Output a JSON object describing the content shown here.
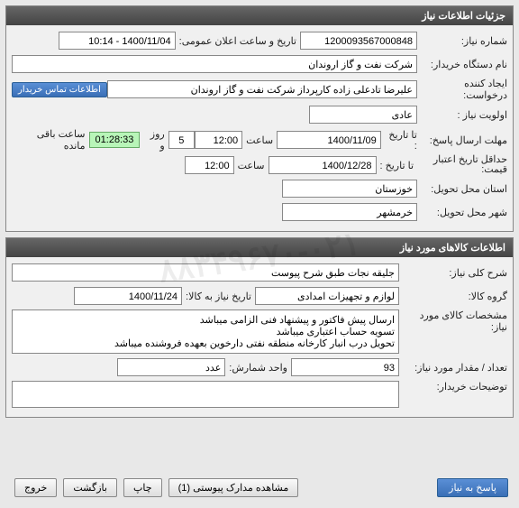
{
  "panel1": {
    "title": "جزئیات اطلاعات نیاز",
    "need_no_label": "شماره نیاز:",
    "need_no": "1200093567000848",
    "announce_label": "تاریخ و ساعت اعلان عمومی:",
    "announce_val": "1400/11/04 - 10:14",
    "buyer_label": "نام دستگاه خریدار:",
    "buyer_val": "شرکت نفت و گاز اروندان",
    "creator_label": "ایجاد کننده درخواست:",
    "creator_val": "علیرضا تادعلی زاده کارپرداز شرکت نفت و گاز اروندان",
    "contact_btn": "اطلاعات تماس خریدار",
    "priority_label": "اولویت نیاز :",
    "priority_val": "عادی",
    "deadline_label": "مهلت ارسال پاسخ:",
    "to_date_label": "تا تاریخ :",
    "deadline_date": "1400/11/09",
    "time_label": "ساعت",
    "deadline_time": "12:00",
    "days_val": "5",
    "days_label": "روز و",
    "countdown": "01:28:33",
    "remaining_label": "ساعت باقی مانده",
    "credit_label": "حداقل تاریخ اعتبار قیمت:",
    "credit_date": "1400/12/28",
    "credit_time": "12:00",
    "province_label": "استان محل تحویل:",
    "province_val": "خوزستان",
    "city_label": "شهر محل تحویل:",
    "city_val": "خرمشهر"
  },
  "panel2": {
    "title": "اطلاعات کالاهای مورد نیاز",
    "desc_label": "شرح کلی نیاز:",
    "desc_val": "جلیقه نجات طبق شرح پیوست",
    "group_label": "گروه کالا:",
    "group_val": "لوازم و تجهیزات امدادی",
    "need_date_label": "تاریخ نیاز به کالا:",
    "need_date_val": "1400/11/24",
    "spec_label": "مشخصات کالای مورد نیاز:",
    "spec_val": "ارسال پیش فاکتور و پیشنهاد فنی الزامی میباشد\nتسویه حساب اعتباری میباشد\nتحویل درب انبار کارخانه منطقه نفتی دارخوین بعهده فروشنده میباشد",
    "qty_label": "تعداد / مقدار مورد نیاز:",
    "qty_val": "93",
    "unit_label": "واحد شمارش:",
    "unit_val": "عدد",
    "notes_label": "توضیحات خریدار:",
    "notes_val": ""
  },
  "footer": {
    "reply": "پاسخ به نیاز",
    "attach": "مشاهده مدارک پیوستی (1)",
    "print": "چاپ",
    "back": "بازگشت",
    "exit": "خروج"
  },
  "watermark": "۸۸۳۴۹۶۷۰-۰۲۱"
}
